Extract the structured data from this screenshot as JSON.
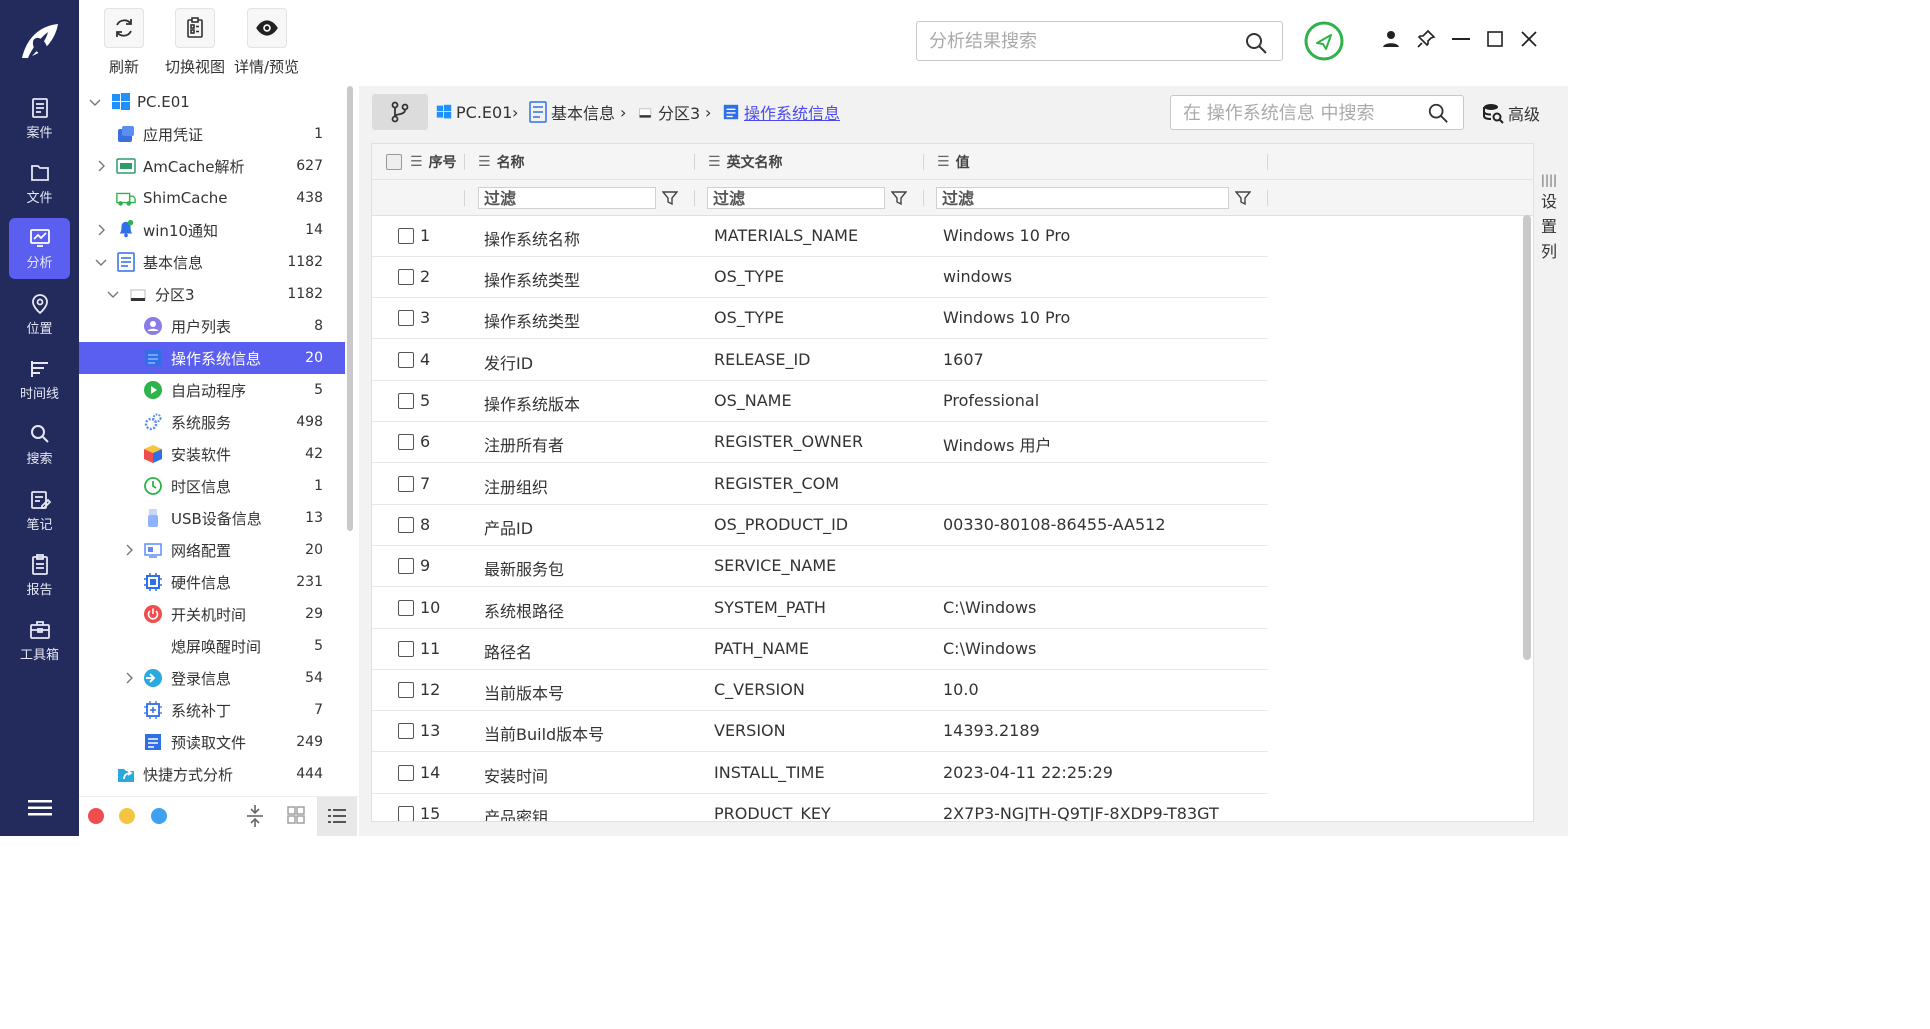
{
  "toolbar": {
    "buttons": [
      {
        "label": "刷新",
        "icon": "refresh-icon"
      },
      {
        "label": "切换视图",
        "icon": "switch-view-icon"
      },
      {
        "label": "详情/预览",
        "icon": "eye-icon"
      }
    ]
  },
  "rail": {
    "items": [
      {
        "label": "案件",
        "icon": "case-icon"
      },
      {
        "label": "文件",
        "icon": "folder-icon"
      },
      {
        "label": "分析",
        "icon": "analysis-icon",
        "active": true
      },
      {
        "label": "位置",
        "icon": "location-icon"
      },
      {
        "label": "时间线",
        "icon": "timeline-icon"
      },
      {
        "label": "搜索",
        "icon": "search-icon"
      },
      {
        "label": "笔记",
        "icon": "notes-icon"
      },
      {
        "label": "报告",
        "icon": "report-icon"
      },
      {
        "label": "工具箱",
        "icon": "toolbox-icon"
      }
    ]
  },
  "tree": [
    {
      "name": "PC.E01",
      "count": ""
    },
    {
      "name": "应用凭证",
      "count": "1"
    },
    {
      "name": "AmCache解析",
      "count": "627"
    },
    {
      "name": "ShimCache",
      "count": "438"
    },
    {
      "name": "win10通知",
      "count": "14"
    },
    {
      "name": "基本信息",
      "count": "1182"
    },
    {
      "name": "分区3",
      "count": "1182"
    },
    {
      "name": "用户列表",
      "count": "8"
    },
    {
      "name": "操作系统信息",
      "count": "20"
    },
    {
      "name": "自启动程序",
      "count": "5"
    },
    {
      "name": "系统服务",
      "count": "498"
    },
    {
      "name": "安装软件",
      "count": "42"
    },
    {
      "name": "时区信息",
      "count": "1"
    },
    {
      "name": "USB设备信息",
      "count": "13"
    },
    {
      "name": "网络配置",
      "count": "20"
    },
    {
      "name": "硬件信息",
      "count": "231"
    },
    {
      "name": "开关机时间",
      "count": "29"
    },
    {
      "name": "熄屏唤醒时间",
      "count": "5"
    },
    {
      "name": "登录信息",
      "count": "54"
    },
    {
      "name": "系统补丁",
      "count": "7"
    },
    {
      "name": "预读取文件",
      "count": "249"
    },
    {
      "name": "快捷方式分析",
      "count": "444"
    }
  ],
  "colors": {
    "rail_bg": "#232a5c",
    "accent": "#5b5ff0",
    "status_green": "#2eb34a",
    "footer_red": "#f04e4e",
    "footer_yellow": "#f5c542",
    "footer_blue": "#3ea0f0"
  },
  "top_search": {
    "placeholder": "分析结果搜索"
  },
  "breadcrumb": [
    "PC.E01",
    "基本信息",
    "分区3",
    "操作系统信息"
  ],
  "inner_search": {
    "placeholder": "在 操作系统信息 中搜索"
  },
  "advanced_label": "高级",
  "columns": {
    "index": "序号",
    "name": "名称",
    "en_name": "英文名称",
    "value": "值"
  },
  "filter_placeholder": "过滤",
  "set_columns_label": [
    "设",
    "置",
    "列"
  ],
  "rows": [
    {
      "idx": "1",
      "name": "操作系统名称",
      "en": "MATERIALS_NAME",
      "value": "Windows 10 Pro"
    },
    {
      "idx": "2",
      "name": "操作系统类型",
      "en": "OS_TYPE",
      "value": "windows"
    },
    {
      "idx": "3",
      "name": "操作系统类型",
      "en": "OS_TYPE",
      "value": "Windows 10 Pro"
    },
    {
      "idx": "4",
      "name": "发行ID",
      "en": "RELEASE_ID",
      "value": "1607"
    },
    {
      "idx": "5",
      "name": "操作系统版本",
      "en": "OS_NAME",
      "value": "Professional"
    },
    {
      "idx": "6",
      "name": "注册所有者",
      "en": "REGISTER_OWNER",
      "value": "Windows 用户"
    },
    {
      "idx": "7",
      "name": "注册组织",
      "en": "REGISTER_COM",
      "value": ""
    },
    {
      "idx": "8",
      "name": "产品ID",
      "en": "OS_PRODUCT_ID",
      "value": "00330-80108-86455-AA512"
    },
    {
      "idx": "9",
      "name": "最新服务包",
      "en": "SERVICE_NAME",
      "value": ""
    },
    {
      "idx": "10",
      "name": "系统根路径",
      "en": "SYSTEM_PATH",
      "value": "C:\\Windows"
    },
    {
      "idx": "11",
      "name": "路径名",
      "en": "PATH_NAME",
      "value": "C:\\Windows"
    },
    {
      "idx": "12",
      "name": "当前版本号",
      "en": "C_VERSION",
      "value": "10.0"
    },
    {
      "idx": "13",
      "name": "当前Build版本号",
      "en": "VERSION",
      "value": "14393.2189"
    },
    {
      "idx": "14",
      "name": "安装时间",
      "en": "INSTALL_TIME",
      "value": "2023-04-11 22:25:29"
    },
    {
      "idx": "15",
      "name": "产品密钥",
      "en": "PRODUCT_KEY",
      "value": "2X7P3-NGJTH-Q9TJF-8XDP9-T83GT"
    }
  ]
}
